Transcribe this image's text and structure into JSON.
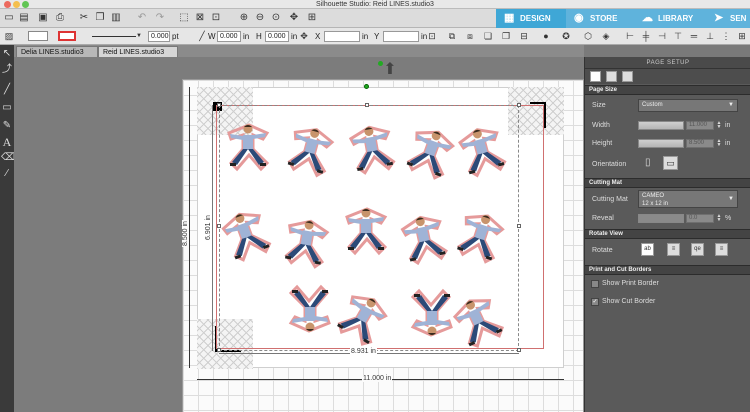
{
  "window": {
    "title": "Silhouette Studio: Reid LINES.studio3"
  },
  "nav": {
    "design": "DESIGN",
    "store": "STORE",
    "library": "LIBRARY",
    "send": "SEN",
    "design_color": "#3fa7d6",
    "store_color": "#3fa7d6",
    "library_color": "#3fa7d6"
  },
  "toolbar": {
    "line_width_value": "0.000",
    "line_width_unit": "pt",
    "w_label": "W",
    "w_value": "0.000",
    "w_unit": "in",
    "h_label": "H",
    "h_value": "0.000",
    "h_unit": "in",
    "x_label": "X",
    "x_unit": "in",
    "y_label": "Y",
    "y_unit": "in"
  },
  "doc_tabs": [
    "Delia LINES.studio3",
    "Reid LINES.studio3"
  ],
  "canvas": {
    "width_dim": "8.931 in",
    "height_dim": "6.901 in",
    "page_height_dim": "8.500 in",
    "page_width_dim": "11.000 in"
  },
  "panel": {
    "title": "PAGE SETUP",
    "page_size_section": "Page Size",
    "size_label": "Size",
    "size_value": "Custom",
    "width_label": "Width",
    "width_value": "11.000",
    "width_unit": "in",
    "height_label": "Height",
    "height_value": "8.500",
    "height_unit": "in",
    "orientation_label": "Orientation",
    "cutting_mat_section": "Cutting Mat",
    "cutting_mat_label": "Cutting Mat",
    "cutting_mat_value_line1": "CAMEO",
    "cutting_mat_value_line2": "12 x 12 in",
    "reveal_label": "Reveal",
    "reveal_value": "0.0",
    "reveal_unit": "%",
    "rotate_view_section": "Rotate View",
    "rotate_label": "Rotate",
    "borders_section": "Print and Cut Borders",
    "show_print_border": "Show Print Border",
    "show_cut_border": "Show Cut Border",
    "show_print_border_checked": false,
    "show_cut_border_checked": true
  }
}
